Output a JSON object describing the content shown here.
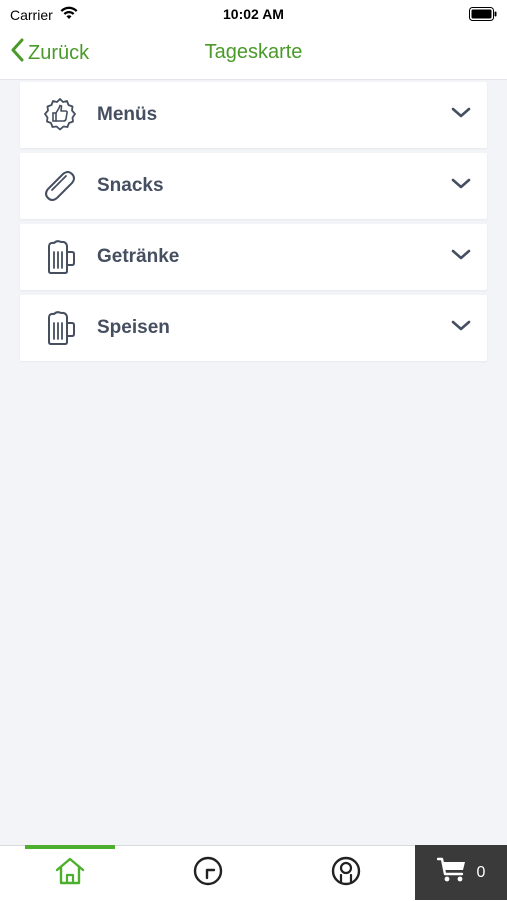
{
  "status_bar": {
    "carrier": "Carrier",
    "time": "10:02 AM"
  },
  "nav": {
    "back_label": "Zurück",
    "title": "Tageskarte"
  },
  "categories": [
    {
      "label": "Menüs",
      "icon": "badge-thumbs-up-icon"
    },
    {
      "label": "Snacks",
      "icon": "baguette-icon"
    },
    {
      "label": "Getränke",
      "icon": "beer-mug-icon"
    },
    {
      "label": "Speisen",
      "icon": "beer-mug-icon"
    }
  ],
  "tab_bar": {
    "active_tab": "home",
    "tabs": [
      "home-icon",
      "clock-icon",
      "profile-icon"
    ]
  },
  "cart": {
    "count": "0"
  },
  "colors": {
    "accent": "#4a9a2a",
    "active_tab_bar": "#4cb02e",
    "icon_gray": "#454f60",
    "cart_bg": "#3a3a3a",
    "page_bg": "#f2f4f8"
  }
}
